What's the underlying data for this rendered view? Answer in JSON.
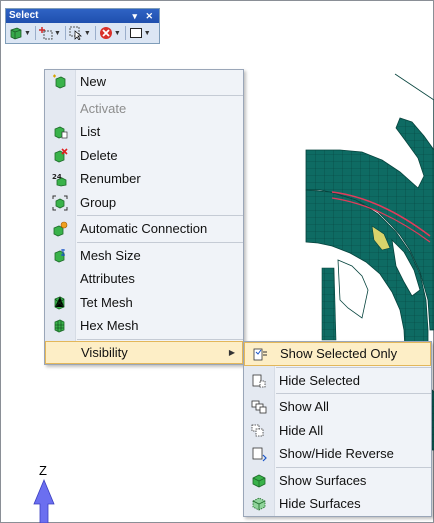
{
  "toolbar": {
    "title": "Select",
    "title_controls": "▾ ✕",
    "buttons": [
      {
        "name": "select-entity",
        "icon": "select-cube-icon",
        "has_dropdown": true
      },
      {
        "name": "select-add",
        "icon": "select-add-icon",
        "has_dropdown": true
      },
      {
        "name": "select-pointer",
        "icon": "pointer-select-icon",
        "has_dropdown": true
      },
      {
        "name": "select-cancel",
        "icon": "cancel-icon",
        "has_dropdown": true
      },
      {
        "name": "select-box",
        "icon": "box-select-icon",
        "has_dropdown": true
      }
    ]
  },
  "axis": {
    "label": "Z"
  },
  "context_menu": {
    "items": [
      {
        "label": "New",
        "icon": "new-icon",
        "enabled": true
      },
      {
        "label": "Activate",
        "icon": "",
        "enabled": false
      },
      {
        "label": "List",
        "icon": "list-icon",
        "enabled": true
      },
      {
        "label": "Delete",
        "icon": "delete-icon",
        "enabled": true
      },
      {
        "label": "Renumber",
        "icon": "renumber-icon",
        "enabled": true
      },
      {
        "label": "Group",
        "icon": "group-icon",
        "enabled": true
      },
      {
        "label": "Automatic Connection",
        "icon": "auto-connection-icon",
        "enabled": true
      },
      {
        "label": "Mesh Size",
        "icon": "mesh-size-icon",
        "enabled": true
      },
      {
        "label": "Attributes",
        "icon": "",
        "enabled": true
      },
      {
        "label": "Tet Mesh",
        "icon": "tet-mesh-icon",
        "enabled": true
      },
      {
        "label": "Hex Mesh",
        "icon": "hex-mesh-icon",
        "enabled": true
      },
      {
        "label": "Visibility",
        "icon": "",
        "enabled": true,
        "submenu": true
      }
    ]
  },
  "visibility_submenu": {
    "items": [
      {
        "label": "Show Selected Only",
        "icon": "show-selected-only-icon"
      },
      {
        "label": "Hide Selected",
        "icon": "hide-selected-icon"
      },
      {
        "label": "Show All",
        "icon": "show-all-icon"
      },
      {
        "label": "Hide All",
        "icon": "hide-all-icon"
      },
      {
        "label": "Show/Hide Reverse",
        "icon": "show-hide-reverse-icon"
      },
      {
        "label": "Show Surfaces",
        "icon": "show-surfaces-icon"
      },
      {
        "label": "Hide Surfaces",
        "icon": "hide-surfaces-icon"
      }
    ]
  },
  "colors": {
    "model": "#0e6b63",
    "menu_highlight": "#fdeec6",
    "axis_arrow": "#6b6ff0",
    "selected_edge": "#e23b5a"
  }
}
